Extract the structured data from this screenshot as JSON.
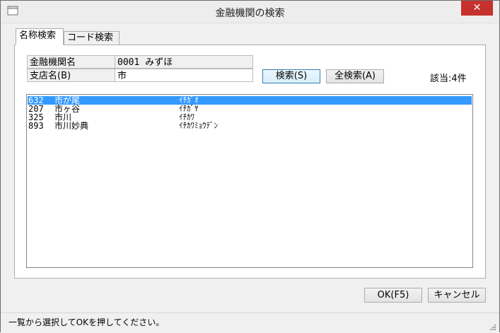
{
  "window": {
    "title": "金融機関の検索",
    "close_label": "✕"
  },
  "tabs": [
    {
      "label": "名称検索",
      "active": true
    },
    {
      "label": "コード検索",
      "active": false
    }
  ],
  "form": {
    "bank_label": "金融機関名",
    "bank_value": "0001 みずほ",
    "branch_label": "支店名(B)",
    "branch_value": "市",
    "search_button": "検索(S)",
    "search_all_button": "全検索(A)",
    "result_count": "該当:4件"
  },
  "results": [
    {
      "code": "632",
      "name": "市が尾",
      "kana": "ｲﾁｶﾞｵ",
      "selected": true
    },
    {
      "code": "207",
      "name": "市ヶ谷",
      "kana": "ｲﾁｶﾞﾔ",
      "selected": false
    },
    {
      "code": "325",
      "name": "市川",
      "kana": "ｲﾁｶﾜ",
      "selected": false
    },
    {
      "code": "893",
      "name": "市川妙典",
      "kana": "ｲﾁｶﾜﾐｮｳﾃﾞﾝ",
      "selected": false
    }
  ],
  "buttons": {
    "ok": "OK(F5)",
    "cancel": "キャンセル"
  },
  "status": {
    "message": "一覧から選択してOKを押してください。"
  },
  "colors": {
    "selection": "#3399ff",
    "close": "#c6312e"
  }
}
